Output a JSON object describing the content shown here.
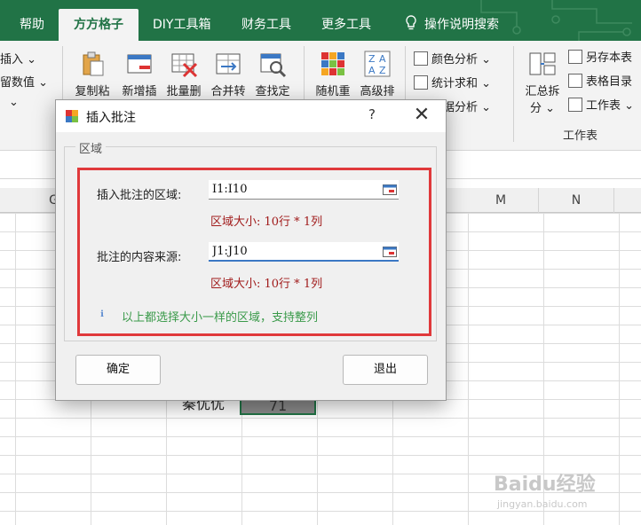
{
  "tabs": [
    {
      "label": "帮助",
      "active": false
    },
    {
      "label": "方方格子",
      "active": true
    },
    {
      "label": "DIY工具箱",
      "active": false
    },
    {
      "label": "财务工具",
      "active": false
    },
    {
      "label": "更多工具",
      "active": false
    },
    {
      "label": "操作说明搜索",
      "active": false
    }
  ],
  "ribbon": {
    "left_partial": [
      "插入",
      "留数值"
    ],
    "buttons": [
      "复制粘",
      "新增插",
      "批量删",
      "合并转",
      "查找定",
      "随机重",
      "高级排"
    ],
    "analysis": [
      "颜色分析",
      "统计求和",
      "数据分析"
    ],
    "summary_button_line1": "汇总拆",
    "summary_button_line2": "分",
    "workbook_items": [
      "另存本表",
      "表格目录",
      "工作表"
    ],
    "group_workbook": "工作表"
  },
  "columns": [
    "G",
    "M",
    "N"
  ],
  "sheet": {
    "name_cell": "秦优优",
    "value_cell": "71"
  },
  "dialog": {
    "title": "插入批注",
    "help": "?",
    "close": "✕",
    "legend": "区域",
    "field1_label": "插入批注的区域:",
    "field1_value": "I1:I10",
    "field1_size": "区域大小:  10行 * 1列",
    "field2_label": "批注的内容来源:",
    "field2_value": "J1:J10",
    "field2_size": "区域大小:  10行 * 1列",
    "tip": "以上都选择大小一样的区域，支持整列",
    "ok_label": "确定",
    "exit_label": "退出"
  },
  "watermark": "Baidu经验",
  "watermark_url": "jingyan.baidu.com"
}
